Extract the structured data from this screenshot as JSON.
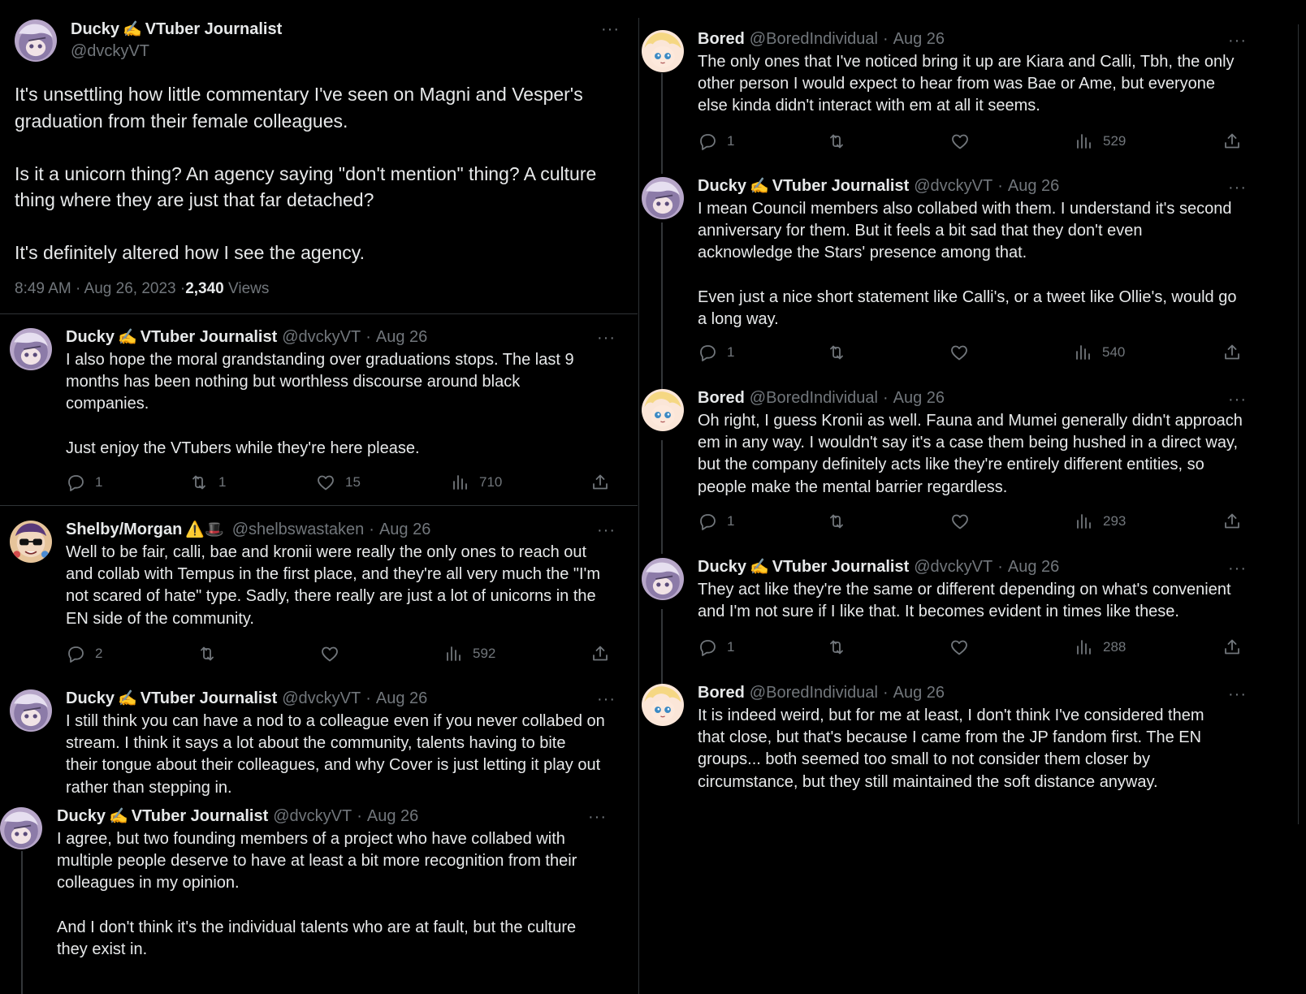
{
  "main_tweet": {
    "author": "Ducky ✍️ VTuber Journalist",
    "handle": "@dvckyVT",
    "text": "It's unsettling how little commentary I've seen on Magni and Vesper's\ngraduation from their female colleagues.\n\nIs it a unicorn thing? An agency saying \"don't mention\" thing? A culture\nthing where they are just that far detached?\n\nIt's definitely altered how I see the agency.",
    "timestamp": "8:49 AM · Aug 26, 2023 · ",
    "views_count": "2,340",
    "views_label": " Views",
    "more": "···"
  },
  "left_replies": [
    {
      "author": "Ducky",
      "author_suffix": "VTuber Journalist",
      "emoji": "✍️",
      "handle": "@dvckyVT",
      "date": "Aug 26",
      "text": "I also hope the moral grandstanding over graduations stops. The last 9\nmonths has been nothing but worthless discourse around black\ncompanies.\n\nJust enjoy the VTubers while they're here please.",
      "replies": "1",
      "reposts": "1",
      "likes": "15",
      "views": "710"
    },
    {
      "author": "Shelby/Morgan",
      "author_suffix": "",
      "emoji": "⚠️🎩",
      "handle": "@shelbswastaken",
      "date": "Aug 26",
      "text": "Well to be fair, calli, bae and kronii were really the only ones to reach out\nand collab with Tempus in the first place, and they're all very much the \"I'm\nnot scared of hate\" type. Sadly, there really are just a lot of unicorns in the\nEN side of the community.",
      "replies": "2",
      "reposts": "",
      "likes": "",
      "views": "592"
    },
    {
      "author": "Ducky",
      "author_suffix": "VTuber Journalist",
      "emoji": "✍️",
      "handle": "@dvckyVT",
      "date": "Aug 26",
      "text": "I still think you can have a nod to a colleague even if you never collabed on\nstream. I think it says a lot about the community, talents having to bite\ntheir tongue about their colleagues, and why Cover is just letting it play out\nrather than stepping in."
    },
    {
      "author": "Ducky",
      "author_suffix": "VTuber Journalist",
      "emoji": "✍️",
      "handle": "@dvckyVT",
      "date": "Aug 26",
      "text": "I agree, but two founding members of a project who have collabed with\nmultiple people deserve to have at least a bit more recognition from their\ncolleagues in my opinion.\n\nAnd I don't think it's the individual talents who are at fault, but the culture\nthey exist in."
    }
  ],
  "right_replies": [
    {
      "author": "Bored",
      "author_suffix": "",
      "emoji": "",
      "handle": "@BoredIndividual",
      "date": "Aug 26",
      "text": "The only ones that I've noticed bring it up are Kiara and Calli, Tbh, the only\nother person I would expect to hear from was Bae or Ame, but everyone\nelse kinda didn't interact with em at all it seems.",
      "replies": "1",
      "views": "529"
    },
    {
      "author": "Ducky",
      "author_suffix": "VTuber Journalist",
      "emoji": "✍️",
      "handle": "@dvckyVT",
      "date": "Aug 26",
      "text": "I mean Council members also collabed with them. I understand it's second\nanniversary for them. But it feels a bit sad that they don't even\nacknowledge the Stars' presence among that.\n\nEven just a nice short statement like Calli's, or a tweet like Ollie's, would go\na long way.",
      "replies": "1",
      "views": "540"
    },
    {
      "author": "Bored",
      "author_suffix": "",
      "emoji": "",
      "handle": "@BoredIndividual",
      "date": "Aug 26",
      "text": "Oh right, I guess Kronii as well. Fauna and Mumei generally didn't approach\nem in any way. I wouldn't say it's a case them being hushed in a direct way,\nbut the company definitely acts like they're entirely different entities, so\npeople make the mental barrier regardless.",
      "replies": "1",
      "views": "293"
    },
    {
      "author": "Ducky",
      "author_suffix": "VTuber Journalist",
      "emoji": "✍️",
      "handle": "@dvckyVT",
      "date": "Aug 26",
      "text": "They act like they're the same or different depending on what's convenient\nand I'm not sure if I like that. It becomes evident in times like these.",
      "replies": "1",
      "views": "288"
    },
    {
      "author": "Bored",
      "author_suffix": "",
      "emoji": "",
      "handle": "@BoredIndividual",
      "date": "Aug 26",
      "text": "It is indeed weird, but for me at least, I don't think I've considered them\nthat close, but that's because I came from the JP fandom first. The EN\ngroups... both seemed too small to not consider them closer by\ncircumstance, but they still maintained the soft distance anyway."
    }
  ],
  "ui": {
    "more": "···",
    "separator": "·"
  },
  "icons": {
    "reply": "reply-icon",
    "repost": "repost-icon",
    "like": "heart-icon",
    "views": "views-icon",
    "share": "share-icon",
    "more": "more-icon"
  },
  "colors": {
    "background": "#000000",
    "text": "#e7e9ea",
    "secondary": "#71767b",
    "divider": "#2f3336"
  }
}
